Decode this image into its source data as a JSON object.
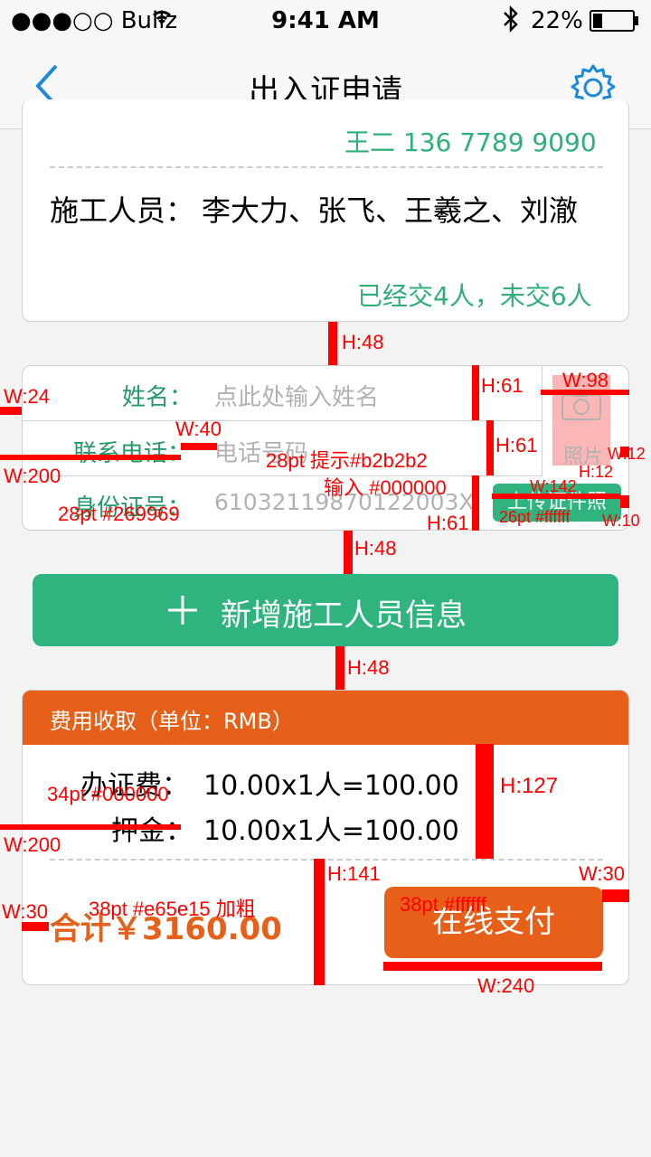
{
  "status": {
    "carrier": "●●●○○ Bullz",
    "time": "9:41 AM",
    "battery": "22%"
  },
  "nav": {
    "title": "出入证申请",
    "back_icon": "back-chevron-icon",
    "settings_icon": "gear-icon"
  },
  "top_card": {
    "partial_line": "王二  136 7789 9090",
    "workers_label": "施工人员：",
    "workers": "李大力、张飞、王羲之、刘澈",
    "summary": "已经交4人，未交6人"
  },
  "form": {
    "name_label": "姓名：",
    "name_placeholder": "点此处输入姓名",
    "phone_label": "联系电话：",
    "phone_placeholder": "电话号码",
    "id_label": "身份证号：",
    "id_value": "61032119870122003X",
    "photo_label": "照片",
    "upload_button": "上传证件照"
  },
  "add_button": {
    "icon": "plus-icon",
    "label": "新增施工人员信息"
  },
  "fee": {
    "header": "费用收取（单位：RMB）",
    "cert_label": "办证费：",
    "cert_value": "10.00x1人=100.00",
    "deposit_label": "押金：",
    "deposit_value": "10.00x1人=100.00",
    "total": "合计￥3160.00",
    "pay_button": "在线支付"
  },
  "annotations": {
    "h48_a": "H:48",
    "h48_b": "H:48",
    "h48_c": "H:48",
    "h61_a": "H:61",
    "h61_b": "H:61",
    "h61_c": "H:61",
    "w98": "W:98",
    "w24": "W:24",
    "w40": "W:40",
    "w200_a": "W:200",
    "w200_b": "W:200",
    "w12": "W:12",
    "h12": "H:12",
    "w142": "W:142",
    "w10": "W:10",
    "hint_spec": "28pt 提示#b2b2b2",
    "input_spec": "输入 #000000",
    "label_spec": "28pt #269969",
    "btn_spec": "26pt #ffffff",
    "h127": "H:127",
    "h141": "H:141",
    "w30_a": "W:30",
    "w30_b": "W:30",
    "w240": "W:240",
    "fee_spec": "34pt #000000",
    "total_spec": "38pt #e65e15 加粗",
    "pay_spec": "38pt #ffffff"
  },
  "colors": {
    "green": "#2fb07a",
    "label_green": "#269969",
    "orange": "#e6601a",
    "hint": "#b2b2b2",
    "annotation": "#ff0000"
  }
}
